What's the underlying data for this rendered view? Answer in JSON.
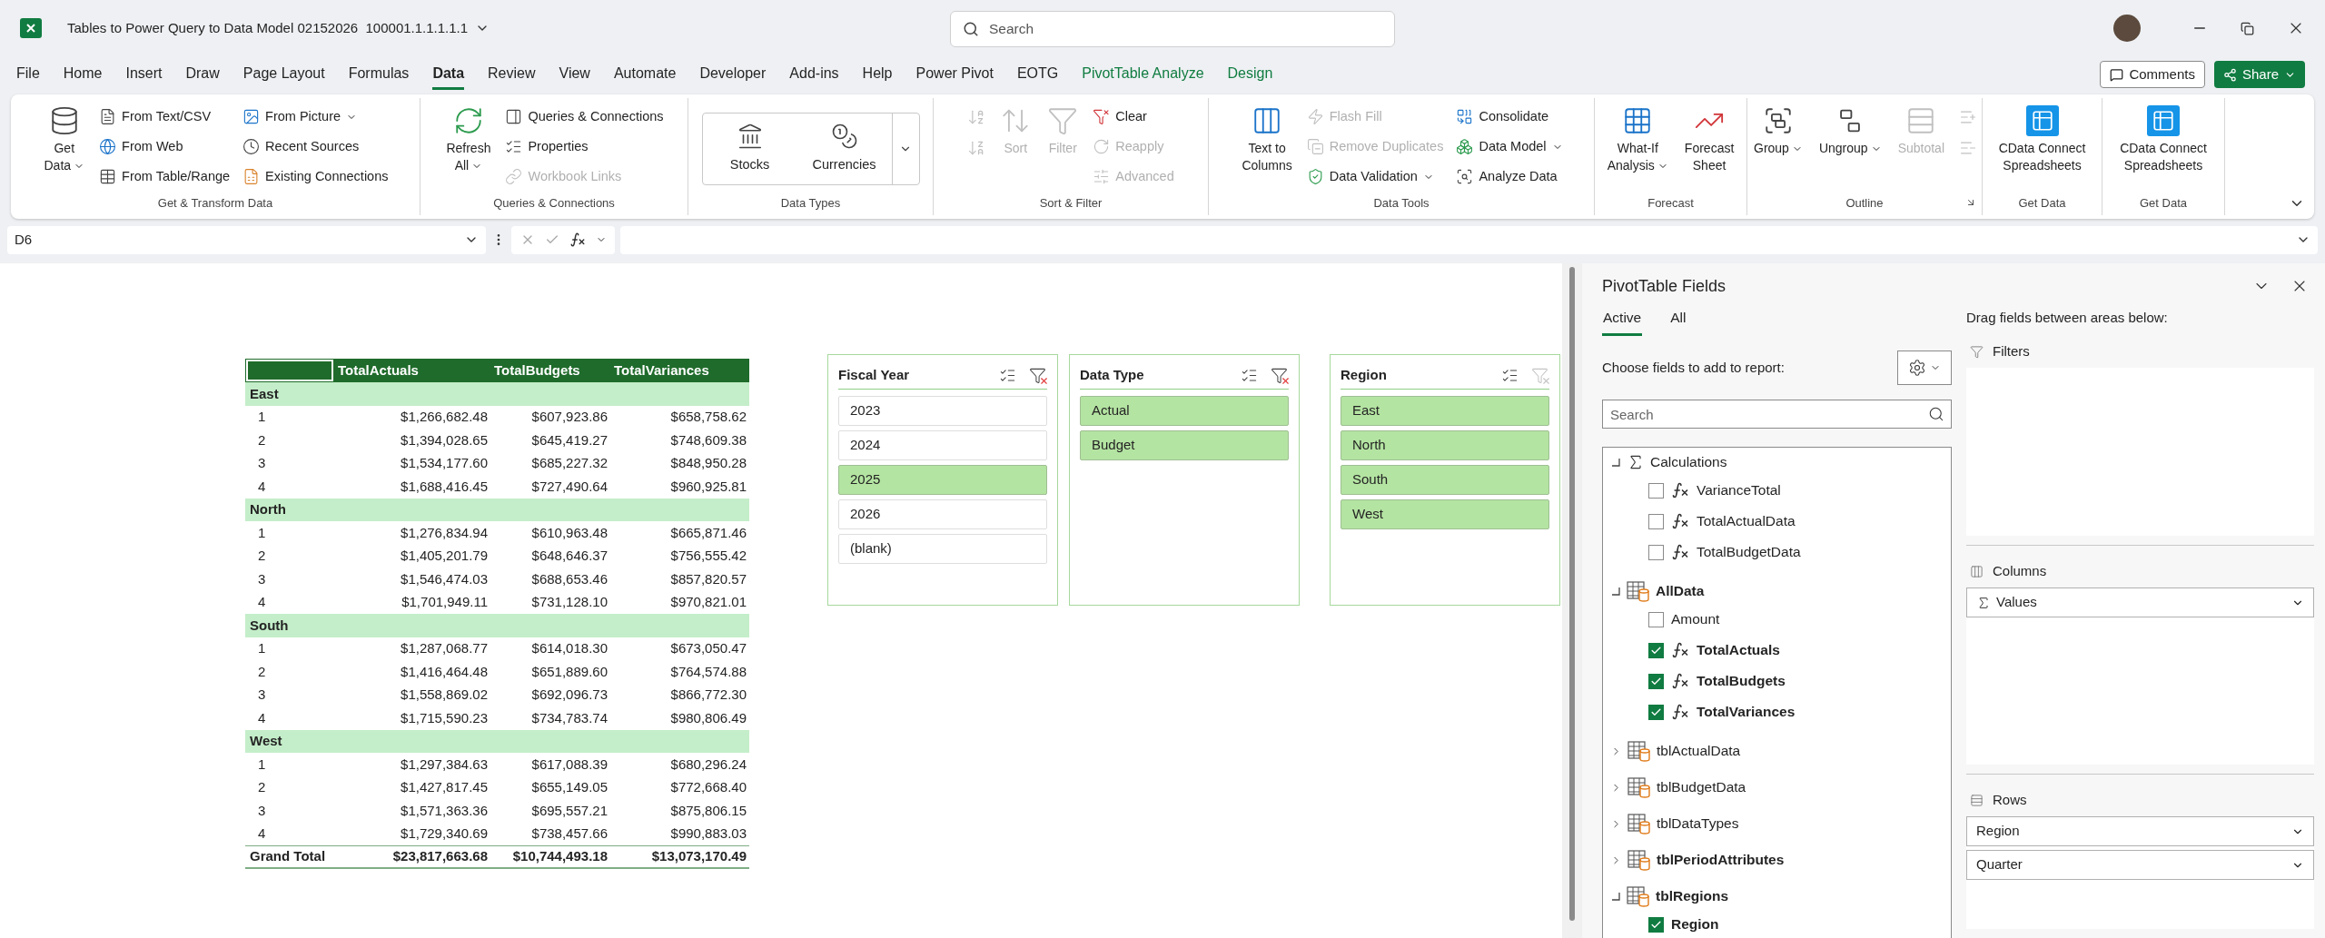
{
  "title_bar": {
    "document_title": "Tables to Power Query to Data Model 02152026  100001.1.1.1.1.1",
    "search_placeholder": "Search"
  },
  "menu_tabs": [
    {
      "label": "File",
      "selected": false,
      "kind": "standard"
    },
    {
      "label": "Home",
      "selected": false,
      "kind": "standard"
    },
    {
      "label": "Insert",
      "selected": false,
      "kind": "standard"
    },
    {
      "label": "Draw",
      "selected": false,
      "kind": "standard"
    },
    {
      "label": "Page Layout",
      "selected": false,
      "kind": "standard"
    },
    {
      "label": "Formulas",
      "selected": false,
      "kind": "standard"
    },
    {
      "label": "Data",
      "selected": true,
      "kind": "standard"
    },
    {
      "label": "Review",
      "selected": false,
      "kind": "standard"
    },
    {
      "label": "View",
      "selected": false,
      "kind": "standard"
    },
    {
      "label": "Automate",
      "selected": false,
      "kind": "standard"
    },
    {
      "label": "Developer",
      "selected": false,
      "kind": "standard"
    },
    {
      "label": "Add-ins",
      "selected": false,
      "kind": "standard"
    },
    {
      "label": "Help",
      "selected": false,
      "kind": "standard"
    },
    {
      "label": "Power Pivot",
      "selected": false,
      "kind": "standard"
    },
    {
      "label": "EOTG",
      "selected": false,
      "kind": "standard"
    },
    {
      "label": "PivotTable Analyze",
      "selected": false,
      "kind": "contextual"
    },
    {
      "label": "Design",
      "selected": false,
      "kind": "contextual"
    }
  ],
  "header_buttons": {
    "comments": "Comments",
    "share": "Share"
  },
  "ribbon": {
    "groups": [
      {
        "label": "Get & Transform Data",
        "kind": "commands",
        "columns": [
          [
            {
              "label": [
                "Get",
                "Data"
              ],
              "kind": "large",
              "dropdown": true,
              "disabled": false
            }
          ],
          [
            {
              "label": [
                "From Text/CSV"
              ],
              "kind": "small",
              "dropdown": false,
              "disabled": false
            },
            {
              "label": [
                "From Web"
              ],
              "kind": "small",
              "dropdown": false,
              "disabled": false
            },
            {
              "label": [
                "From Table/Range"
              ],
              "kind": "small",
              "dropdown": false,
              "disabled": false
            }
          ],
          [
            {
              "label": [
                "From Picture"
              ],
              "kind": "small",
              "dropdown": true,
              "disabled": false
            },
            {
              "label": [
                "Recent Sources"
              ],
              "kind": "small",
              "dropdown": false,
              "disabled": false
            },
            {
              "label": [
                "Existing Connections"
              ],
              "kind": "small",
              "dropdown": false,
              "disabled": false
            }
          ]
        ]
      },
      {
        "label": "Queries & Connections",
        "kind": "commands",
        "columns": [
          [
            {
              "label": [
                "Refresh",
                "All"
              ],
              "kind": "large",
              "dropdown": true,
              "disabled": false
            }
          ],
          [
            {
              "label": [
                "Queries & Connections"
              ],
              "kind": "small",
              "dropdown": false,
              "disabled": false
            },
            {
              "label": [
                "Properties"
              ],
              "kind": "small",
              "dropdown": false,
              "disabled": false
            },
            {
              "label": [
                "Workbook Links"
              ],
              "kind": "small",
              "dropdown": false,
              "disabled": true
            }
          ]
        ]
      },
      {
        "label": "Data Types",
        "kind": "gallery",
        "items": [
          {
            "label": "Stocks"
          },
          {
            "label": "Currencies"
          }
        ]
      },
      {
        "label": "Sort & Filter",
        "kind": "commands",
        "columns": [
          [
            {
              "kind": "icon",
              "disabled": true
            },
            {
              "kind": "icon",
              "disabled": true
            }
          ],
          [
            {
              "label": [
                "Sort"
              ],
              "kind": "large",
              "dropdown": false,
              "disabled": true
            }
          ],
          [
            {
              "label": [
                "Filter"
              ],
              "kind": "large",
              "dropdown": false,
              "disabled": true
            }
          ],
          [
            {
              "label": [
                "Clear"
              ],
              "kind": "small",
              "dropdown": false,
              "disabled": false
            },
            {
              "label": [
                "Reapply"
              ],
              "kind": "small",
              "dropdown": false,
              "disabled": true
            },
            {
              "label": [
                "Advanced"
              ],
              "kind": "small",
              "dropdown": false,
              "disabled": true
            }
          ]
        ]
      },
      {
        "label": "Data Tools",
        "kind": "commands",
        "columns": [
          [
            {
              "label": [
                "Text to",
                "Columns"
              ],
              "kind": "large",
              "dropdown": false,
              "disabled": false
            }
          ],
          [
            {
              "label": [
                "Flash Fill"
              ],
              "kind": "small",
              "dropdown": false,
              "disabled": true
            },
            {
              "label": [
                "Remove Duplicates"
              ],
              "kind": "small",
              "dropdown": false,
              "disabled": true
            },
            {
              "label": [
                "Data Validation"
              ],
              "kind": "small",
              "dropdown": true,
              "disabled": false
            }
          ],
          [
            {
              "label": [
                "Consolidate"
              ],
              "kind": "small",
              "dropdown": false,
              "disabled": false
            },
            {
              "label": [
                "Data Model"
              ],
              "kind": "small",
              "dropdown": true,
              "disabled": false
            },
            {
              "label": [
                "Analyze Data"
              ],
              "kind": "small",
              "dropdown": false,
              "disabled": false
            }
          ]
        ]
      },
      {
        "label": "Forecast",
        "kind": "commands",
        "columns": [
          [
            {
              "label": [
                "What-If",
                "Analysis"
              ],
              "kind": "large",
              "dropdown": true,
              "disabled": false
            }
          ],
          [
            {
              "label": [
                "Forecast",
                "Sheet"
              ],
              "kind": "large",
              "dropdown": false,
              "disabled": false
            }
          ]
        ]
      },
      {
        "label": "Outline",
        "kind": "commands",
        "launcher": true,
        "columns": [
          [
            {
              "label": [
                "Group"
              ],
              "kind": "large",
              "dropdown": true,
              "disabled": false
            }
          ],
          [
            {
              "label": [
                "Ungroup"
              ],
              "kind": "large",
              "dropdown": true,
              "disabled": false
            }
          ],
          [
            {
              "label": [
                "Subtotal"
              ],
              "kind": "large",
              "dropdown": false,
              "disabled": true
            }
          ],
          [
            {
              "kind": "icon",
              "disabled": true
            },
            {
              "kind": "icon",
              "disabled": true
            }
          ]
        ]
      },
      {
        "label": "Get Data",
        "kind": "commands",
        "columns": [
          [
            {
              "label": [
                "CData Connect",
                "Spreadsheets"
              ],
              "kind": "large",
              "dropdown": false,
              "disabled": false
            }
          ]
        ]
      },
      {
        "label": "Get Data",
        "kind": "commands",
        "columns": [
          [
            {
              "label": [
                "CData Connect",
                "Spreadsheets"
              ],
              "kind": "large",
              "dropdown": false,
              "disabled": false
            }
          ]
        ]
      }
    ]
  },
  "formula_bar": {
    "name_box": "D6"
  },
  "pivot_table": {
    "columns": [
      "TotalActuals",
      "TotalBudgets",
      "TotalVariances"
    ],
    "groups": [
      {
        "label": "East",
        "rows": [
          {
            "label": "1",
            "values": [
              "$1,266,682.48",
              "$607,923.86",
              "$658,758.62"
            ]
          },
          {
            "label": "2",
            "values": [
              "$1,394,028.65",
              "$645,419.27",
              "$748,609.38"
            ]
          },
          {
            "label": "3",
            "values": [
              "$1,534,177.60",
              "$685,227.32",
              "$848,950.28"
            ]
          },
          {
            "label": "4",
            "values": [
              "$1,688,416.45",
              "$727,490.64",
              "$960,925.81"
            ]
          }
        ]
      },
      {
        "label": "North",
        "rows": [
          {
            "label": "1",
            "values": [
              "$1,276,834.94",
              "$610,963.48",
              "$665,871.46"
            ]
          },
          {
            "label": "2",
            "values": [
              "$1,405,201.79",
              "$648,646.37",
              "$756,555.42"
            ]
          },
          {
            "label": "3",
            "values": [
              "$1,546,474.03",
              "$688,653.46",
              "$857,820.57"
            ]
          },
          {
            "label": "4",
            "values": [
              "$1,701,949.11",
              "$731,128.10",
              "$970,821.01"
            ]
          }
        ]
      },
      {
        "label": "South",
        "rows": [
          {
            "label": "1",
            "values": [
              "$1,287,068.77",
              "$614,018.30",
              "$673,050.47"
            ]
          },
          {
            "label": "2",
            "values": [
              "$1,416,464.48",
              "$651,889.60",
              "$764,574.88"
            ]
          },
          {
            "label": "3",
            "values": [
              "$1,558,869.02",
              "$692,096.73",
              "$866,772.30"
            ]
          },
          {
            "label": "4",
            "values": [
              "$1,715,590.23",
              "$734,783.74",
              "$980,806.49"
            ]
          }
        ]
      },
      {
        "label": "West",
        "rows": [
          {
            "label": "1",
            "values": [
              "$1,297,384.63",
              "$617,088.39",
              "$680,296.24"
            ]
          },
          {
            "label": "2",
            "values": [
              "$1,427,817.45",
              "$655,149.05",
              "$772,668.40"
            ]
          },
          {
            "label": "3",
            "values": [
              "$1,571,363.36",
              "$695,557.21",
              "$875,806.15"
            ]
          },
          {
            "label": "4",
            "values": [
              "$1,729,340.69",
              "$738,457.66",
              "$990,883.03"
            ]
          }
        ]
      }
    ],
    "grand_total": {
      "label": "Grand Total",
      "values": [
        "$23,817,663.68",
        "$10,744,493.18",
        "$13,073,170.49"
      ]
    }
  },
  "slicers": [
    {
      "title": "Fiscal Year",
      "filtered": true,
      "items": [
        {
          "label": "2023",
          "selected": false
        },
        {
          "label": "2024",
          "selected": false
        },
        {
          "label": "2025",
          "selected": true
        },
        {
          "label": "2026",
          "selected": false
        },
        {
          "label": "(blank)",
          "selected": false
        }
      ]
    },
    {
      "title": "Data Type",
      "filtered": true,
      "items": [
        {
          "label": "Actual",
          "selected": true
        },
        {
          "label": "Budget",
          "selected": true
        }
      ]
    },
    {
      "title": "Region",
      "filtered": false,
      "items": [
        {
          "label": "East",
          "selected": true
        },
        {
          "label": "North",
          "selected": true
        },
        {
          "label": "South",
          "selected": true
        },
        {
          "label": "West",
          "selected": true
        }
      ]
    }
  ],
  "field_list": {
    "title": "PivotTable Fields",
    "tabs": [
      {
        "label": "Active",
        "selected": true
      },
      {
        "label": "All",
        "selected": false
      }
    ],
    "instruction": "Choose fields to add to report:",
    "search_placeholder": "Search",
    "tree": [
      {
        "label": "Calculations",
        "kind": "calculations",
        "expanded": true,
        "in_use": false,
        "children": [
          {
            "label": "VarianceTotal",
            "kind": "measure",
            "checked": false
          },
          {
            "label": "TotalActualData",
            "kind": "measure",
            "checked": false
          },
          {
            "label": "TotalBudgetData",
            "kind": "measure",
            "checked": false
          }
        ]
      },
      {
        "label": "AllData",
        "kind": "table",
        "expanded": true,
        "in_use": true,
        "children": [
          {
            "label": "Amount",
            "kind": "column",
            "checked": false
          },
          {
            "label": "TotalActuals",
            "kind": "measure",
            "checked": true
          },
          {
            "label": "TotalBudgets",
            "kind": "measure",
            "checked": true
          },
          {
            "label": "TotalVariances",
            "kind": "measure",
            "checked": true
          }
        ]
      },
      {
        "label": "tblActualData",
        "kind": "table",
        "expanded": false,
        "in_use": false
      },
      {
        "label": "tblBudgetData",
        "kind": "table",
        "expanded": false,
        "in_use": false
      },
      {
        "label": "tblDataTypes",
        "kind": "table",
        "expanded": false,
        "in_use": false
      },
      {
        "label": "tblPeriodAttributes",
        "kind": "table",
        "expanded": false,
        "in_use": true
      },
      {
        "label": "tblRegions",
        "kind": "table",
        "expanded": true,
        "in_use": true,
        "children": [
          {
            "label": "Region",
            "kind": "column",
            "checked": true
          }
        ]
      }
    ],
    "areas_instruction": "Drag fields between areas below:",
    "areas": [
      {
        "title": "Filters",
        "kind": "filters"
      },
      {
        "title": "Columns",
        "kind": "columns",
        "items": [
          {
            "label": "Values",
            "kind": "values"
          }
        ]
      },
      {
        "title": "Rows",
        "kind": "rows",
        "items": [
          {
            "label": "Region",
            "kind": "field"
          },
          {
            "label": "Quarter",
            "kind": "field"
          }
        ]
      }
    ]
  }
}
